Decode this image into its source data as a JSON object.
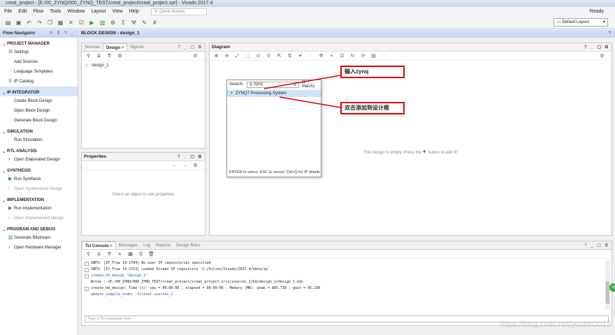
{
  "window": {
    "title": "creat_project - [E:/00_ZYNQ/000_ZYNQ_TEST/creat_project/creat_project.xpr] - Vivado 2017.4",
    "status": "Ready"
  },
  "menu": [
    "File",
    "Edit",
    "Flow",
    "Tools",
    "Window",
    "Layout",
    "View",
    "Help"
  ],
  "quick_access": {
    "placeholder": "Quick Access"
  },
  "layout_selector": {
    "value": "Default Layout"
  },
  "flow_navigator": {
    "title": "Flow Navigator",
    "sections": [
      {
        "label": "PROJECT MANAGER",
        "items": [
          "Settings",
          "Add Sources",
          "Language Templates",
          "IP Catalog"
        ]
      },
      {
        "label": "IP INTEGRATOR",
        "items": [
          "Create Block Design",
          "Open Block Design",
          "Generate Block Design"
        ]
      },
      {
        "label": "SIMULATION",
        "items": [
          "Run Simulation"
        ]
      },
      {
        "label": "RTL ANALYSIS",
        "items": [
          "Open Elaborated Design"
        ]
      },
      {
        "label": "SYNTHESIS",
        "items": [
          "Run Synthesis",
          "Open Synthesized Design"
        ]
      },
      {
        "label": "IMPLEMENTATION",
        "items": [
          "Run Implementation",
          "Open Implemented Design"
        ]
      },
      {
        "label": "PROGRAM AND DEBUG",
        "items": [
          "Generate Bitstream",
          "Open Hardware Manager"
        ]
      }
    ]
  },
  "block_design": {
    "header": "BLOCK DESIGN - design_1"
  },
  "sources_panel": {
    "tabs": [
      "Sources",
      "Design",
      "Signals"
    ],
    "tree_item": "design_1"
  },
  "properties_panel": {
    "title": "Properties",
    "empty_msg": "Select an object to see properties"
  },
  "diagram": {
    "title": "Diagram",
    "empty_msg_pre": "This design is empty. Press the",
    "empty_msg_post": "button to add IP"
  },
  "ip_search": {
    "label": "Search:",
    "query": "zynq",
    "match_count": "(1 match)",
    "result": "ZYNQ7 Processing System",
    "footer": "ENTER to select, ESC to cancel, Ctrl+Q for IP details"
  },
  "callouts": {
    "type_hint": "输入zynq",
    "dblclick_hint": "双击添加到设计框"
  },
  "tcl": {
    "tabs": [
      "Tcl Console",
      "Messages",
      "Log",
      "Reports",
      "Design Runs"
    ],
    "lines": [
      "INFO: [IP_Flow 19-1704] No user IP repositories specified",
      "INFO: [IP_Flow 19-2313] Loaded Vivado IP repository 'C:/Xilinx/Vivado/2017.4/data/ip'.",
      "create_bd_design \"design_1\"",
      "Wrote  : <E:/00_ZYNQ/000_ZYNQ_TEST/creat_project/creat_project.srcs/sources_1/bd/design_1/design_1.bd>",
      "create_bd_design: Time (s): cpu = 00:00:06 ; elapsed = 00:00:06 . Memory (MB): peak = 885.738 ; gain = 95.230",
      "update_compile_order -fileset sources_1"
    ],
    "input_placeholder": "Type a Tcl command here"
  },
  "watermark": "https://blog.csdn.net/youbin2013"
}
